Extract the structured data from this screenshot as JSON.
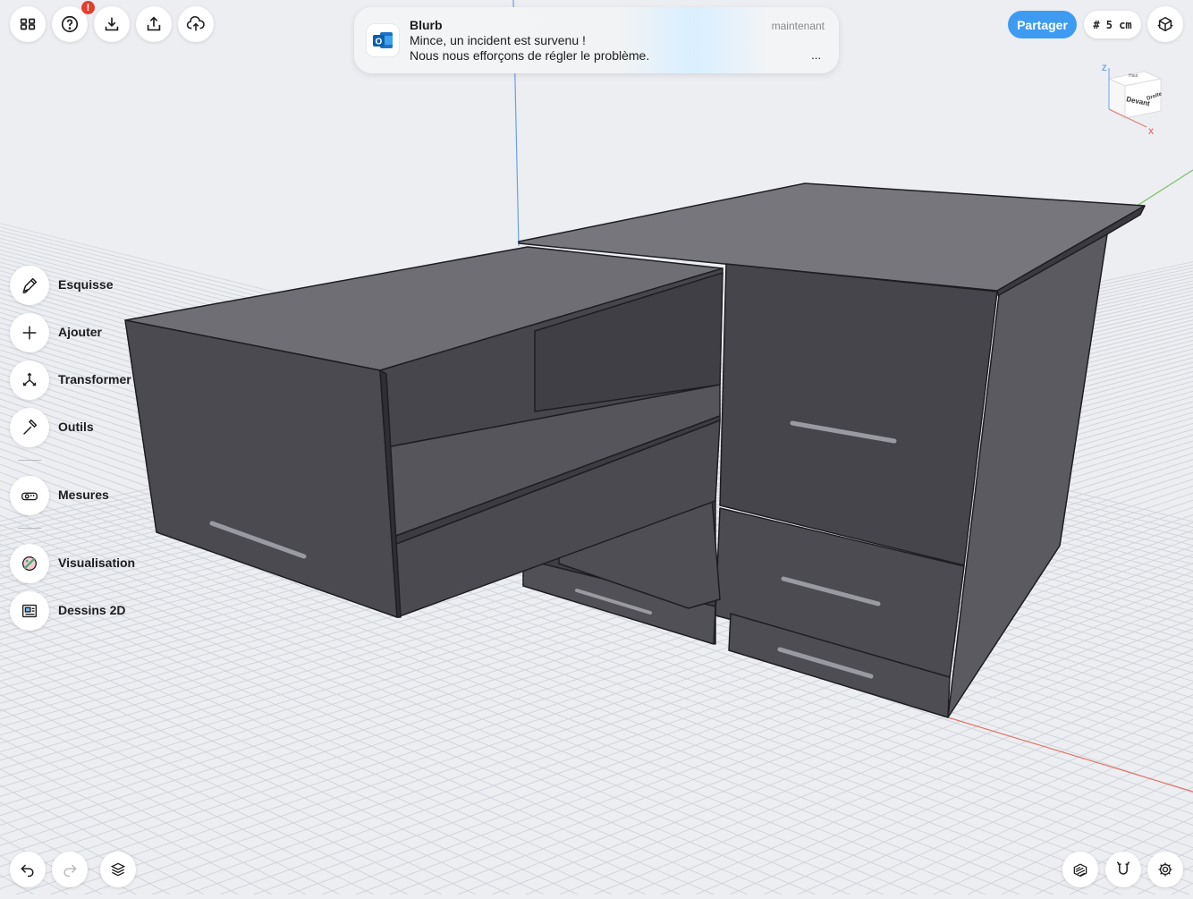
{
  "toolbar": {
    "icons": [
      "grid-icon",
      "help-icon",
      "download-icon",
      "upload-icon",
      "cloud-upload-icon"
    ],
    "help_badge": "!"
  },
  "notification": {
    "app": "Blurb",
    "time": "maintenant",
    "line1": "Mince, un incident est survenu !",
    "line2": "Nous nous efforçons de régler le problème.",
    "more": "...",
    "icon": "outlook-icon"
  },
  "header_right": {
    "share_label": "Partager",
    "grid_label": "# 5 cm",
    "view_icon": "view-options-icon"
  },
  "view_cube": {
    "front": "Devant",
    "right": "Droite",
    "top": "Haut",
    "axis_z": "Z",
    "axis_x": "X"
  },
  "sidebar": {
    "items": [
      {
        "label": "Esquisse",
        "icon": "pencil-icon"
      },
      {
        "label": "Ajouter",
        "icon": "plus-icon"
      },
      {
        "label": "Transformer",
        "icon": "transform-icon"
      },
      {
        "label": "Outils",
        "icon": "hammer-icon"
      },
      {
        "label": "Mesures",
        "icon": "tape-measure-icon"
      },
      {
        "label": "Visualisation",
        "icon": "palette-icon"
      },
      {
        "label": "Dessins 2D",
        "icon": "blueprint-icon"
      }
    ]
  },
  "bottom": {
    "left_icons": [
      "undo-icon",
      "redo-icon",
      "layers-icon"
    ],
    "right_icons": [
      "section-icon",
      "snap-magnet-icon",
      "settings-icon"
    ]
  },
  "colors": {
    "accent": "#3d9bf2",
    "badge": "#e53e2e",
    "background": "#eceef2",
    "model_dark": "#4a4a50",
    "model_top": "#76767c"
  }
}
